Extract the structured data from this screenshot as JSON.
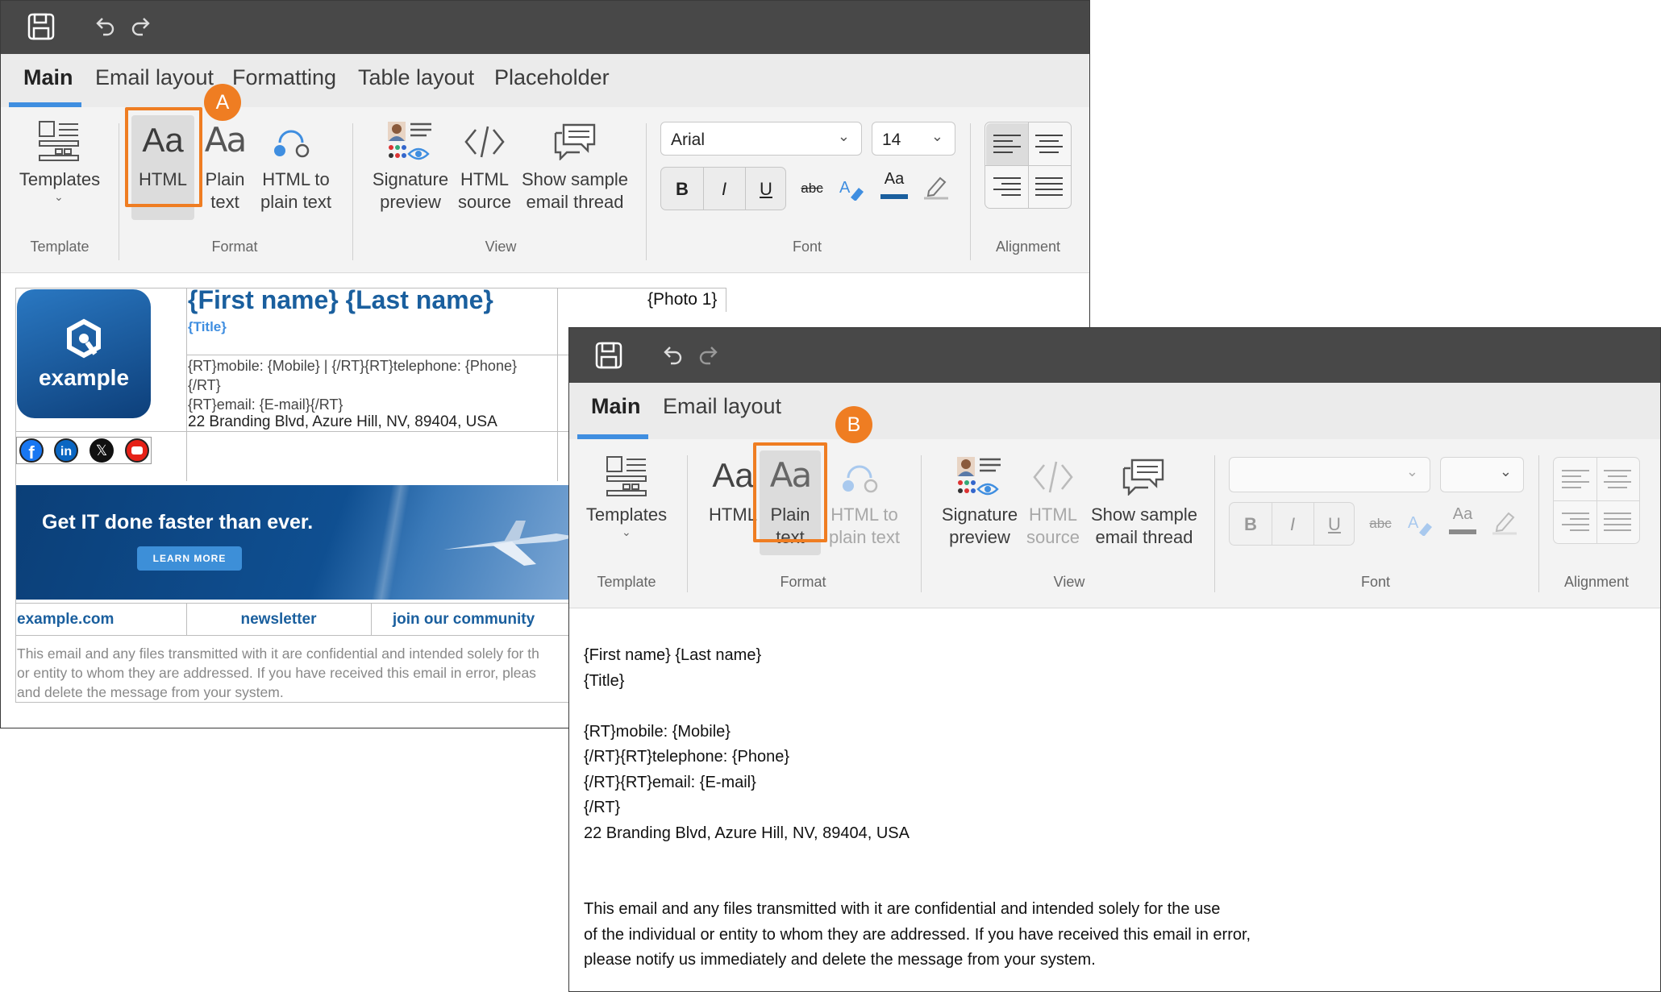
{
  "window_a": {
    "tabs": [
      "Main",
      "Email layout",
      "Formatting",
      "Table layout",
      "Placeholder"
    ],
    "ribbon": {
      "templates_label": "Templates",
      "html_label": "HTML",
      "plain_label_1": "Plain",
      "plain_label_2": "text",
      "html2plain_1": "HTML to",
      "html2plain_2": "plain text",
      "sigprev_1": "Signature",
      "sigprev_2": "preview",
      "htmlsrc_1": "HTML",
      "htmlsrc_2": "source",
      "thread_1": "Show sample",
      "thread_2": "email thread",
      "font_name": "Arial",
      "font_size": "14",
      "bold": "B",
      "italic": "I",
      "underline": "U",
      "strike": "abc",
      "fontcolor": "Aa",
      "aa_glyph": "Aa",
      "groups": {
        "template": "Template",
        "format": "Format",
        "view": "View",
        "font": "Font",
        "alignment": "Alignment"
      }
    },
    "badge": "A",
    "signature": {
      "name": "{First name} {Last name}",
      "title": "{Title}",
      "photo": "{Photo 1}",
      "logo_text": "example",
      "mobile_line": "{RT}mobile: {Mobile}  |  {/RT}{RT}telephone: {Phone}",
      "rt_close": "{/RT}",
      "email_line": "{RT}email: {E-mail}{/RT}",
      "address": "22 Branding Blvd, Azure Hill, NV, 89404, USA",
      "banner_text": "Get IT done faster than ever.",
      "banner_button": "LEARN MORE",
      "links": [
        "example.com",
        "newsletter",
        "join our community"
      ],
      "disclaimer_1": "This email and any files transmitted with it are confidential and intended solely for th",
      "disclaimer_2": "or entity to whom they are addressed. If you have received this email in error, pleas",
      "disclaimer_3": "and delete the message from your system."
    }
  },
  "window_b": {
    "tabs": [
      "Main",
      "Email layout"
    ],
    "badge": "B",
    "ribbon": {
      "templates_label": "Templates",
      "html_label": "HTML",
      "plain_label_1": "Plain",
      "plain_label_2": "text",
      "html2plain_1": "HTML to",
      "html2plain_2": "plain text",
      "sigprev_1": "Signature",
      "sigprev_2": "preview",
      "htmlsrc_1": "HTML",
      "htmlsrc_2": "source",
      "thread_1": "Show sample",
      "thread_2": "email thread",
      "bold": "B",
      "italic": "I",
      "underline": "U",
      "strike": "abc",
      "fontcolor": "Aa",
      "aa_glyph": "Aa",
      "groups": {
        "template": "Template",
        "format": "Format",
        "view": "View",
        "font": "Font",
        "alignment": "Alignment"
      }
    },
    "plain_lines": [
      "{First name} {Last name}",
      "{Title}",
      "",
      "{RT}mobile: {Mobile}",
      "{/RT}{RT}telephone: {Phone}",
      "{/RT}{RT}email: {E-mail}",
      "{/RT}",
      "22 Branding Blvd, Azure Hill, NV, 89404, USA",
      "",
      "",
      "This email and any files transmitted with it are confidential and intended solely for the use",
      "of the individual or entity to whom they are addressed. If you have received this email in error,",
      "please notify us immediately and delete the message from your system."
    ]
  },
  "colors": {
    "accent": "#3f8ee0",
    "highlight": "#ef7d22",
    "brand_blue": "#1a5f9e",
    "titlebar": "#484848"
  }
}
